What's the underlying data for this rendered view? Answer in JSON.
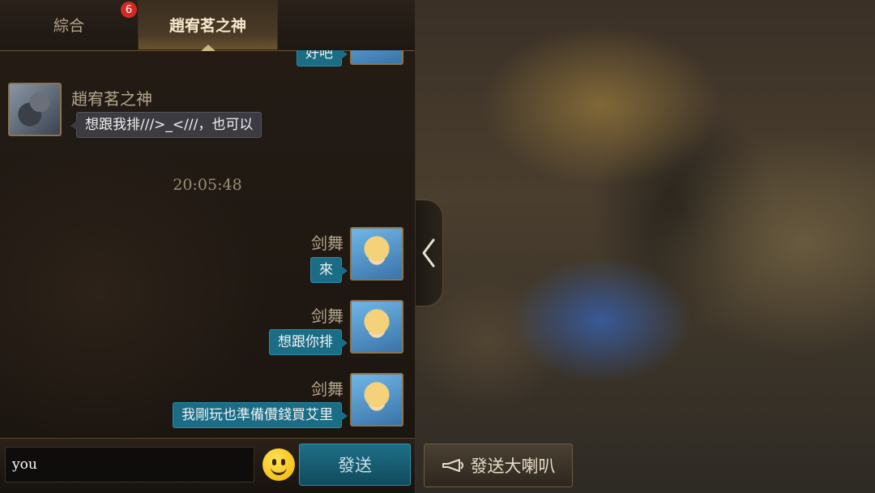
{
  "tabs": [
    {
      "label": "綜合",
      "badge": "6"
    },
    {
      "label": "趙宥茗之神",
      "active": true
    }
  ],
  "messages": {
    "partial_top": {
      "text": "好吧"
    },
    "other": {
      "sender": "趙宥茗之神",
      "text": "想跟我排///>_<///，也可以"
    },
    "timestamp": "20:05:48",
    "self": [
      {
        "sender": "剑舞",
        "text": "來"
      },
      {
        "sender": "剑舞",
        "text": "想跟你排"
      },
      {
        "sender": "剑舞",
        "text": "我剛玩也準備儹錢買艾里"
      }
    ]
  },
  "input": {
    "value": "you"
  },
  "send_label": "發送",
  "horn_label": "發送大喇叭",
  "colors": {
    "self_bubble": "#1b6d86",
    "other_bubble": "#3b3b41",
    "badge": "#d22a22"
  },
  "icons": [
    "chevron-left-icon",
    "smiley-icon",
    "horn-icon"
  ]
}
